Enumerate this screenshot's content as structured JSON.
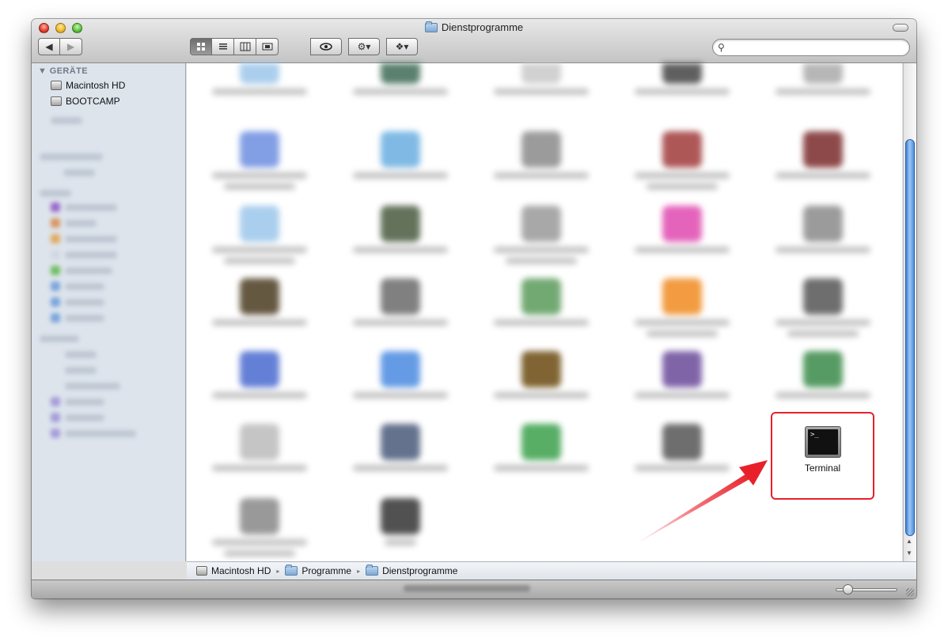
{
  "window": {
    "title": "Dienstprogramme"
  },
  "toolbar": {
    "back_label": "◀",
    "forward_label": "▶",
    "view_icon": "icon-view",
    "list_view": "list-view",
    "column_view": "column-view",
    "coverflow_view": "coverflow-view",
    "quicklook_label": "👁",
    "action_label": "⚙▾",
    "dropbox_label": "❖▾"
  },
  "search": {
    "placeholder": "",
    "icon": "search-icon"
  },
  "sidebar": {
    "devices_header": "▼ GERÄTE",
    "devices": [
      {
        "label": "Macintosh HD"
      },
      {
        "label": "BOOTCAMP"
      }
    ]
  },
  "selected_item": {
    "label": "Terminal",
    "icon": "terminal-icon",
    "prompt": ">_"
  },
  "pathbar": {
    "items": [
      {
        "label": "Macintosh HD"
      },
      {
        "label": "Programme"
      },
      {
        "label": "Dienstprogramme"
      }
    ],
    "separator": "▸"
  },
  "colors": {
    "highlight": "#e8202a",
    "scroll_thumb": "#4f90e0"
  }
}
